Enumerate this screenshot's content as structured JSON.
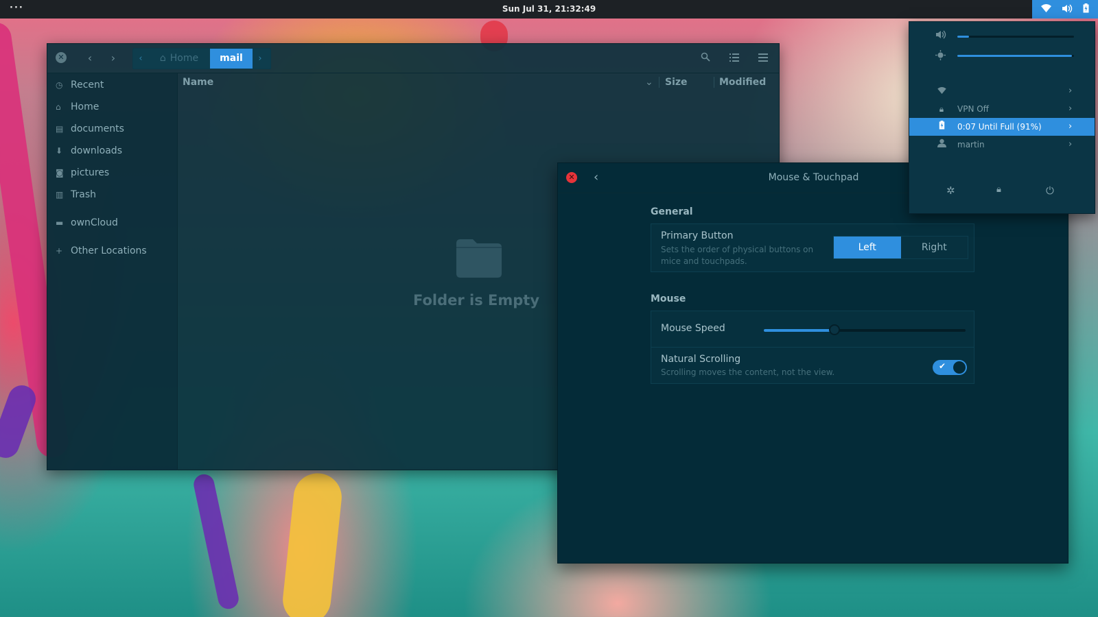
{
  "topbar": {
    "activities": "···",
    "clock": "Sun Jul 31, 21:32:49",
    "tray_icons": [
      "wifi-icon",
      "volume-icon",
      "battery-icon"
    ]
  },
  "files": {
    "path": {
      "home": "Home",
      "current": "mail"
    },
    "sidebar": [
      {
        "label": "Recent",
        "icon": "clock-icon"
      },
      {
        "label": "Home",
        "icon": "home-icon"
      },
      {
        "label": "documents",
        "icon": "document-icon"
      },
      {
        "label": "downloads",
        "icon": "download-icon"
      },
      {
        "label": "pictures",
        "icon": "camera-icon"
      },
      {
        "label": "Trash",
        "icon": "trash-icon"
      },
      {
        "label": "ownCloud",
        "icon": "folder-icon"
      },
      {
        "label": "Other Locations",
        "icon": "plus-icon"
      }
    ],
    "columns": {
      "name": "Name",
      "size": "Size",
      "modified": "Modified"
    },
    "empty_text": "Folder is Empty"
  },
  "settings": {
    "title": "Mouse & Touchpad",
    "general": {
      "section": "General",
      "primary_button_title": "Primary Button",
      "primary_button_sub": "Sets the order of physical buttons on mice and touchpads.",
      "options": [
        "Left",
        "Right"
      ],
      "selected": "Left"
    },
    "mouse": {
      "section": "Mouse",
      "speed_title": "Mouse Speed",
      "speed_fraction": 0.35,
      "natural_title": "Natural Scrolling",
      "natural_sub": "Scrolling moves the content, not the view.",
      "natural_enabled": true
    }
  },
  "sysmenu": {
    "volume_fraction": 0.1,
    "brightness_fraction": 0.98,
    "rows": [
      {
        "label": "",
        "icon": "wifi-icon"
      },
      {
        "label": "VPN Off",
        "icon": "lock-icon"
      },
      {
        "label": "0:07 Until Full (91%)",
        "icon": "battery-icon"
      },
      {
        "label": "martin",
        "icon": "user-icon"
      }
    ],
    "bottom": [
      "settings-icon",
      "lock-icon",
      "power-icon"
    ]
  },
  "colors": {
    "accent": "#2f8fde",
    "window_bg": "#0c303c",
    "close_red": "#e5343a"
  }
}
